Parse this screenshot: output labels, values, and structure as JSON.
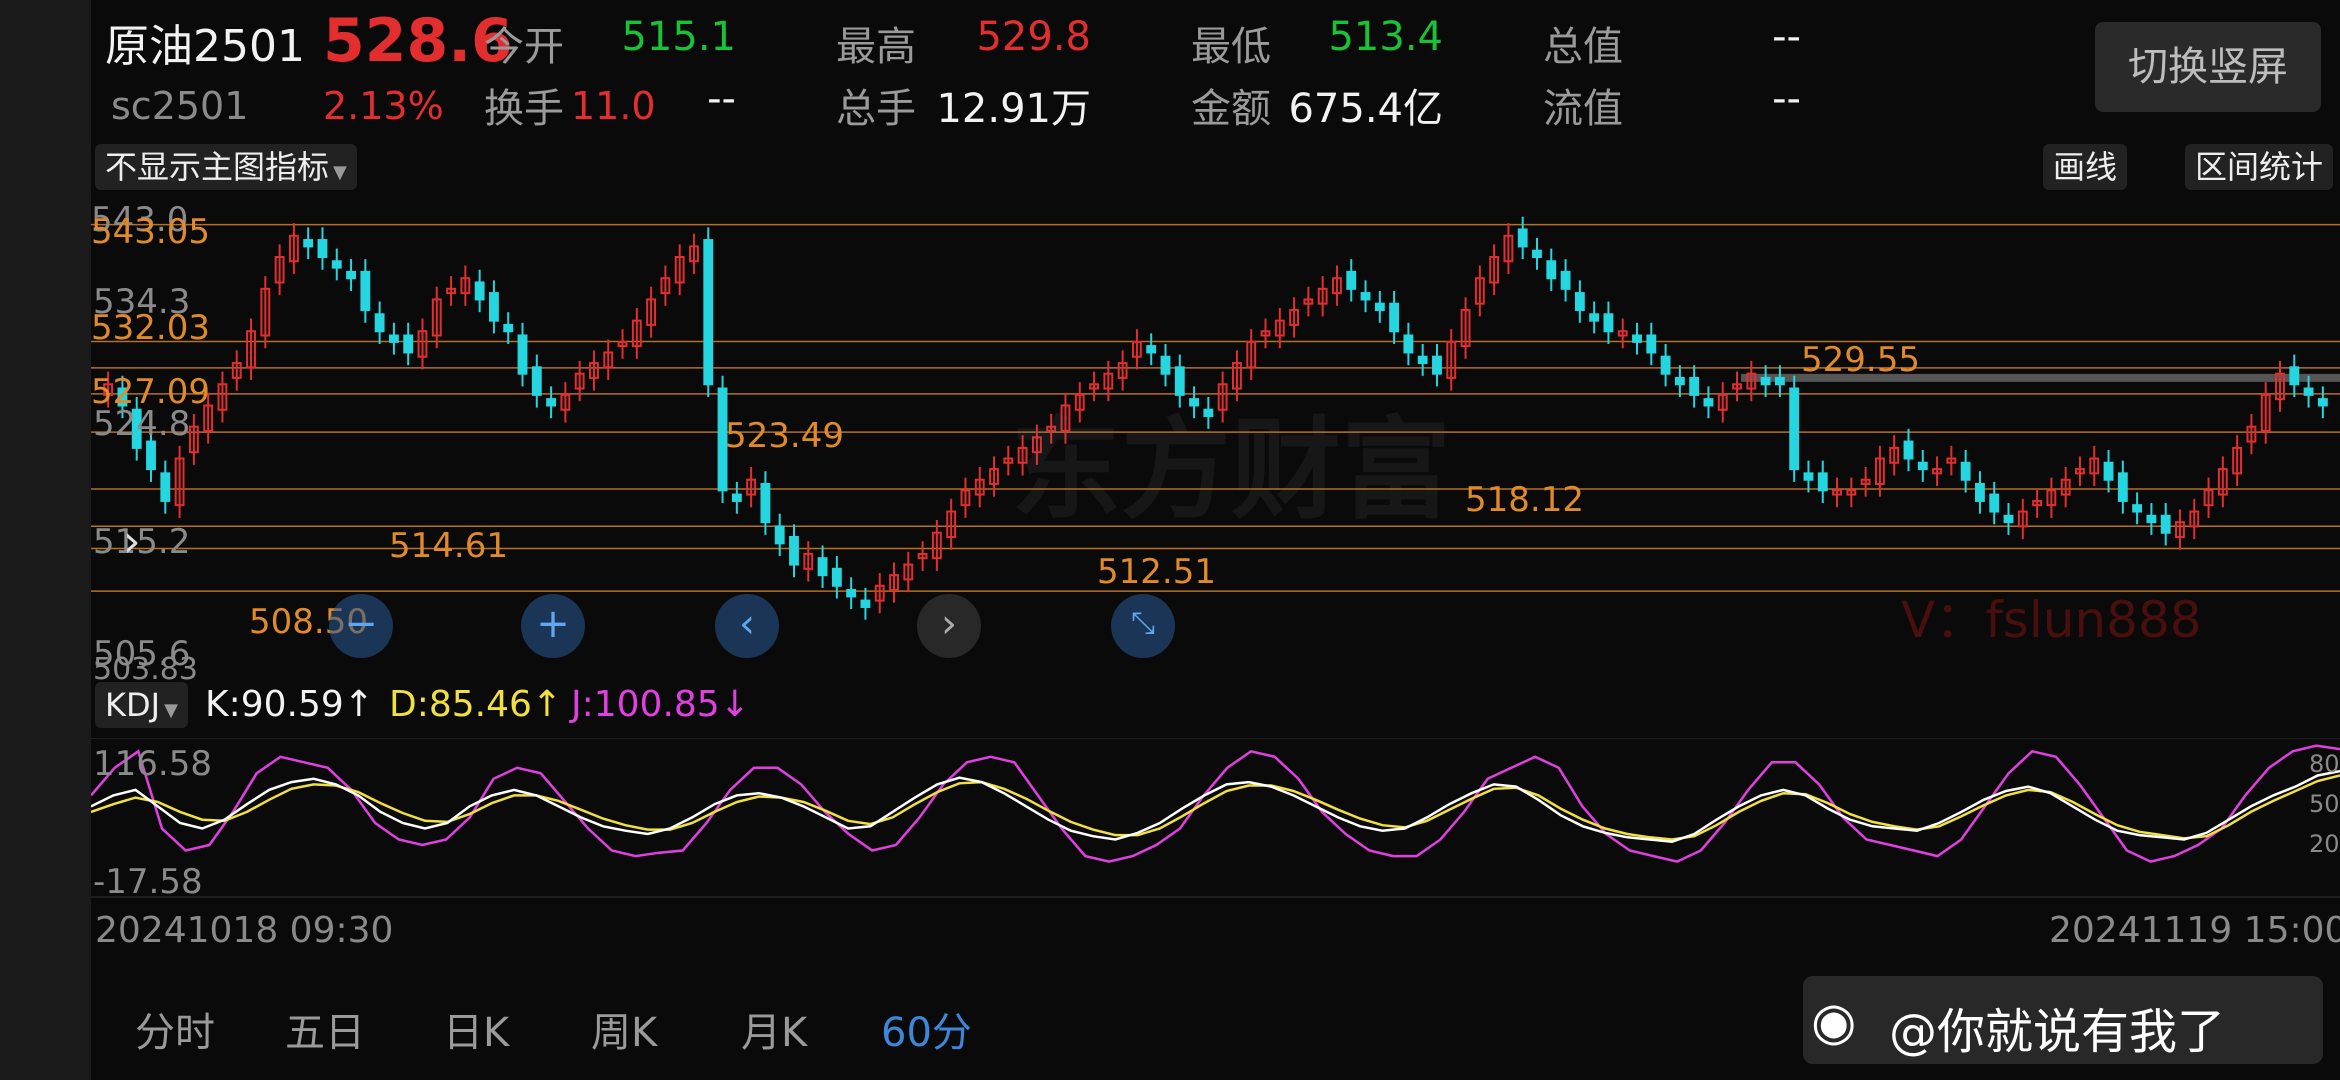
{
  "header": {
    "name": "原油2501",
    "price": "528.6",
    "code": "sc2501",
    "change_pct": "2.13%",
    "change_val": "11.0",
    "stats": [
      {
        "label": "今开",
        "value": "515.1",
        "color": "green"
      },
      {
        "label": "最高",
        "value": "529.8",
        "color": "red"
      },
      {
        "label": "最低",
        "value": "513.4",
        "color": "green"
      },
      {
        "label": "总值",
        "value": "--",
        "color": "white"
      },
      {
        "label": "换手",
        "value": "--",
        "color": "white"
      },
      {
        "label": "总手",
        "value": "12.91万",
        "color": "white"
      },
      {
        "label": "金额",
        "value": "675.4亿",
        "color": "white"
      },
      {
        "label": "流值",
        "value": "--",
        "color": "white"
      }
    ],
    "switch_btn": "切换竖屏"
  },
  "toolbar": {
    "indicator_select": "不显示主图指标",
    "draw_btn": "画线",
    "range_btn": "区间统计"
  },
  "price_axis": {
    "labels": [
      "543.0",
      "543.05",
      "534.3",
      "532.03",
      "527.09",
      "524.8",
      "515.2",
      "505.6",
      "503.83"
    ]
  },
  "level_labels": [
    "529.55",
    "523.49",
    "518.12",
    "514.61",
    "512.51",
    "508.50"
  ],
  "watermark": {
    "brand": "东方财富",
    "author": "V：fslun888"
  },
  "kdj": {
    "selector": "KDJ",
    "k": "K:90.59↑",
    "d": "D:85.46↑",
    "j": "J:100.85↓",
    "top": "116.58",
    "bottom": "-17.58",
    "right_labels": [
      "80",
      "50",
      "20"
    ]
  },
  "time_axis": {
    "start": "20241018 09:30",
    "end": "20241119 15:00"
  },
  "periods": [
    {
      "label": "分时",
      "active": false
    },
    {
      "label": "五日",
      "active": false
    },
    {
      "label": "日K",
      "active": false
    },
    {
      "label": "周K",
      "active": false
    },
    {
      "label": "月K",
      "active": false
    },
    {
      "label": "60分",
      "active": true
    }
  ],
  "weibo": "@你就说有我了",
  "colors": {
    "up": "#e22e2e",
    "down": "#25d6e0",
    "ma_line": "#e08a2a",
    "k": "#ffffff",
    "d": "#f0e040",
    "j": "#e040e0",
    "active": "#3d86d8"
  },
  "chart_data": {
    "type": "candlestick",
    "title": "原油2501 60分",
    "ylim": [
      502,
      545
    ],
    "hlines": [
      543.05,
      532.03,
      529.55,
      527.09,
      523.49,
      518.12,
      514.61,
      512.51,
      508.5
    ],
    "close": [
      528,
      526,
      522,
      520,
      517,
      521,
      524,
      526,
      528,
      530,
      533,
      537,
      540,
      542,
      541,
      540,
      539,
      538,
      535,
      533,
      532,
      531,
      533,
      536,
      537,
      538,
      536,
      534,
      533,
      529,
      527,
      526,
      527,
      529,
      530,
      531,
      532,
      534,
      536,
      538,
      540,
      541,
      528,
      518,
      517,
      519,
      515,
      513,
      511,
      512,
      510,
      509,
      508,
      507,
      509,
      510,
      511,
      512,
      514,
      516,
      518,
      519,
      520,
      521,
      522,
      523,
      524,
      526,
      527,
      528,
      529,
      530,
      532,
      531,
      529,
      527,
      526,
      525,
      528,
      530,
      532,
      533,
      534,
      535,
      536,
      537,
      538,
      537,
      536,
      535,
      533,
      531,
      530,
      529,
      532,
      535,
      538,
      540,
      542,
      541,
      540,
      538,
      537,
      535,
      534,
      533,
      533,
      532,
      531,
      529,
      528,
      527,
      526,
      527,
      528,
      529,
      528,
      528,
      520,
      519,
      518,
      518,
      518,
      519,
      521,
      522,
      521,
      520,
      520,
      521,
      519,
      517,
      516,
      515,
      516,
      517,
      518,
      519,
      520,
      521,
      519,
      517,
      516,
      515,
      514,
      515,
      516,
      518,
      520,
      522,
      524,
      527,
      529,
      528,
      527,
      526
    ],
    "kdj": {
      "k": [
        60,
        70,
        75,
        60,
        45,
        40,
        48,
        62,
        75,
        82,
        85,
        80,
        70,
        55,
        45,
        40,
        45,
        60,
        70,
        75,
        70,
        60,
        50,
        42,
        38,
        35,
        40,
        50,
        62,
        70,
        72,
        68,
        60,
        50,
        40,
        42,
        55,
        68,
        80,
        86,
        82,
        72,
        60,
        48,
        38,
        33,
        30,
        36,
        45,
        58,
        70,
        80,
        82,
        78,
        70,
        60,
        50,
        42,
        38,
        40,
        50,
        62,
        72,
        80,
        78,
        66,
        52,
        42,
        36,
        32,
        30,
        28,
        35,
        48,
        60,
        70,
        75,
        70,
        58,
        48,
        42,
        40,
        38,
        45,
        55,
        66,
        74,
        78,
        72,
        60,
        48,
        38,
        34,
        32,
        30,
        36,
        48,
        60,
        70,
        78,
        88,
        92
      ],
      "d": [
        55,
        62,
        68,
        64,
        55,
        48,
        47,
        55,
        66,
        76,
        80,
        79,
        73,
        63,
        54,
        47,
        46,
        53,
        63,
        70,
        70,
        65,
        57,
        49,
        43,
        39,
        39,
        45,
        55,
        64,
        69,
        68,
        64,
        56,
        47,
        44,
        50,
        62,
        73,
        81,
        82,
        76,
        67,
        56,
        46,
        39,
        34,
        34,
        40,
        51,
        63,
        74,
        79,
        79,
        74,
        66,
        57,
        49,
        43,
        41,
        47,
        57,
        67,
        76,
        77,
        70,
        58,
        48,
        40,
        35,
        32,
        30,
        33,
        43,
        55,
        65,
        72,
        71,
        63,
        53,
        46,
        42,
        39,
        42,
        51,
        61,
        70,
        75,
        73,
        64,
        53,
        43,
        37,
        34,
        31,
        33,
        43,
        55,
        65,
        74,
        83,
        88
      ],
      "j": [
        70,
        95,
        110,
        40,
        20,
        25,
        55,
        90,
        105,
        100,
        95,
        75,
        45,
        30,
        25,
        30,
        50,
        85,
        95,
        90,
        65,
        40,
        20,
        15,
        18,
        20,
        45,
        75,
        95,
        95,
        80,
        55,
        35,
        20,
        25,
        50,
        80,
        100,
        105,
        100,
        70,
        40,
        15,
        10,
        15,
        25,
        40,
        70,
        95,
        110,
        105,
        85,
        55,
        35,
        20,
        15,
        15,
        30,
        55,
        85,
        95,
        105,
        95,
        60,
        35,
        20,
        15,
        10,
        20,
        45,
        75,
        100,
        100,
        80,
        50,
        30,
        25,
        20,
        15,
        30,
        60,
        90,
        110,
        105,
        80,
        50,
        20,
        10,
        15,
        25,
        40,
        70,
        95,
        110,
        115,
        112
      ]
    }
  }
}
